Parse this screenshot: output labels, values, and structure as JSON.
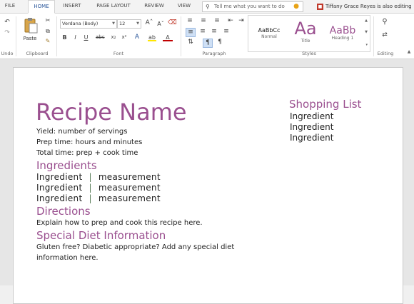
{
  "tabs": [
    "FILE",
    "HOME",
    "INSERT",
    "PAGE LAYOUT",
    "REVIEW",
    "VIEW"
  ],
  "tell_me": {
    "placeholder": "Tell me what you want to do"
  },
  "user_status": "Tiffany Grace Reyes is also editing",
  "ribbon": {
    "groups": {
      "undo": "Undo",
      "clipboard": "Clipboard",
      "font": "Font",
      "paragraph": "Paragraph",
      "styles": "Styles",
      "editing": "Editing"
    },
    "paste_label": "Paste",
    "font_name": "Verdana (Body)",
    "font_size": "12",
    "styles": [
      {
        "sample": "AaBbCc",
        "name": "Normal"
      },
      {
        "sample": "Aa",
        "name": "Title"
      },
      {
        "sample": "AaBb",
        "name": "Heading 1"
      }
    ],
    "colors": {
      "accent": "#2b579a",
      "highlight": "#ffe600",
      "font_color": "#c00000"
    }
  },
  "document": {
    "title": "Recipe Name",
    "yield": "Yield: number of servings",
    "prep": "Prep time: hours and minutes",
    "total": "Total time: prep + cook time",
    "ingredients_heading": "Ingredients",
    "ingredients": [
      {
        "name": "Ingredient",
        "sep": "|",
        "measure": "measurement"
      },
      {
        "name": "Ingredient",
        "sep": "|",
        "measure": "measurement"
      },
      {
        "name": "Ingredient",
        "sep": "|",
        "measure": "measurement"
      }
    ],
    "directions_heading": "Directions",
    "directions_text": "Explain how to prep and cook this recipe here.",
    "diet_heading": "Special Diet Information",
    "diet_text_1": "Gluten free? Diabetic appropriate? Add any special diet",
    "diet_text_2": "information here.",
    "shopping_heading": "Shopping List",
    "shopping_items": [
      "Ingredient",
      "Ingredient",
      "Ingredient"
    ],
    "heading_color": "#9a4f8f"
  }
}
